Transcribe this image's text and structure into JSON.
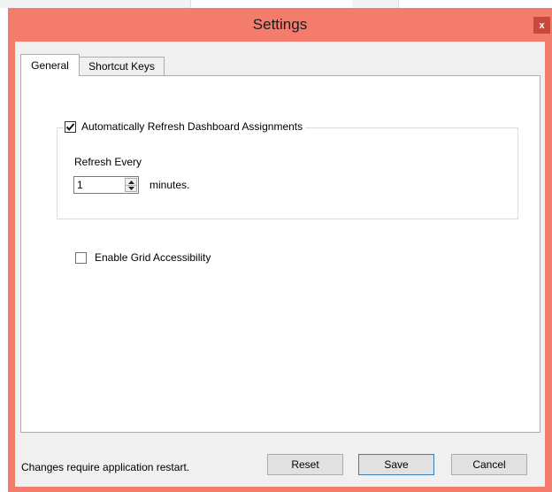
{
  "window": {
    "title": "Settings",
    "close_glyph": "x",
    "accent_color": "#f47c6d"
  },
  "tabs": [
    {
      "label": "General",
      "active": true
    },
    {
      "label": "Shortcut Keys",
      "active": false
    }
  ],
  "general": {
    "auto_refresh": {
      "label": "Automatically Refresh Dashboard Assignments",
      "checked": true
    },
    "refresh_every_label": "Refresh Every",
    "refresh_interval_value": "1",
    "minutes_label": "minutes.",
    "grid_accessibility": {
      "label": "Enable Grid Accessibility",
      "checked": false
    }
  },
  "footer": {
    "restart_notice": "Changes require application restart.",
    "reset_label": "Reset",
    "save_label": "Save",
    "cancel_label": "Cancel"
  }
}
